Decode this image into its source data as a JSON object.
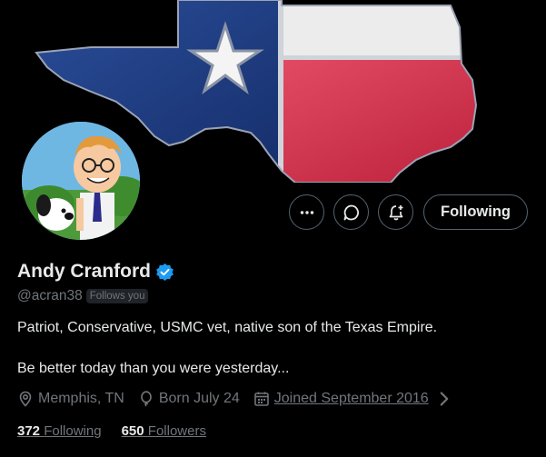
{
  "profile": {
    "display_name": "Andy Cranford",
    "handle": "@acran38",
    "follows_you": "Follows you",
    "bio_line1": "Patriot, Conservative, USMC vet, native son of the Texas Empire.",
    "bio_line2": "Be better today than you were yesterday...",
    "location": "Memphis, TN",
    "birthday": "Born July 24",
    "joined": "Joined September 2016",
    "following_count": "372",
    "following_label": "Following",
    "followers_count": "650",
    "followers_label": "Followers"
  },
  "actions": {
    "more_icon": "more-icon",
    "message_icon": "message-icon",
    "notify_icon": "notification-bell-icon",
    "follow_label": "Following"
  },
  "colors": {
    "background": "#000000",
    "verified_badge": "#1d9bf0",
    "texas_blue": "#1f3f86",
    "texas_red": "#d5243f",
    "texas_white": "#ececec",
    "muted_text": "#71767b"
  }
}
